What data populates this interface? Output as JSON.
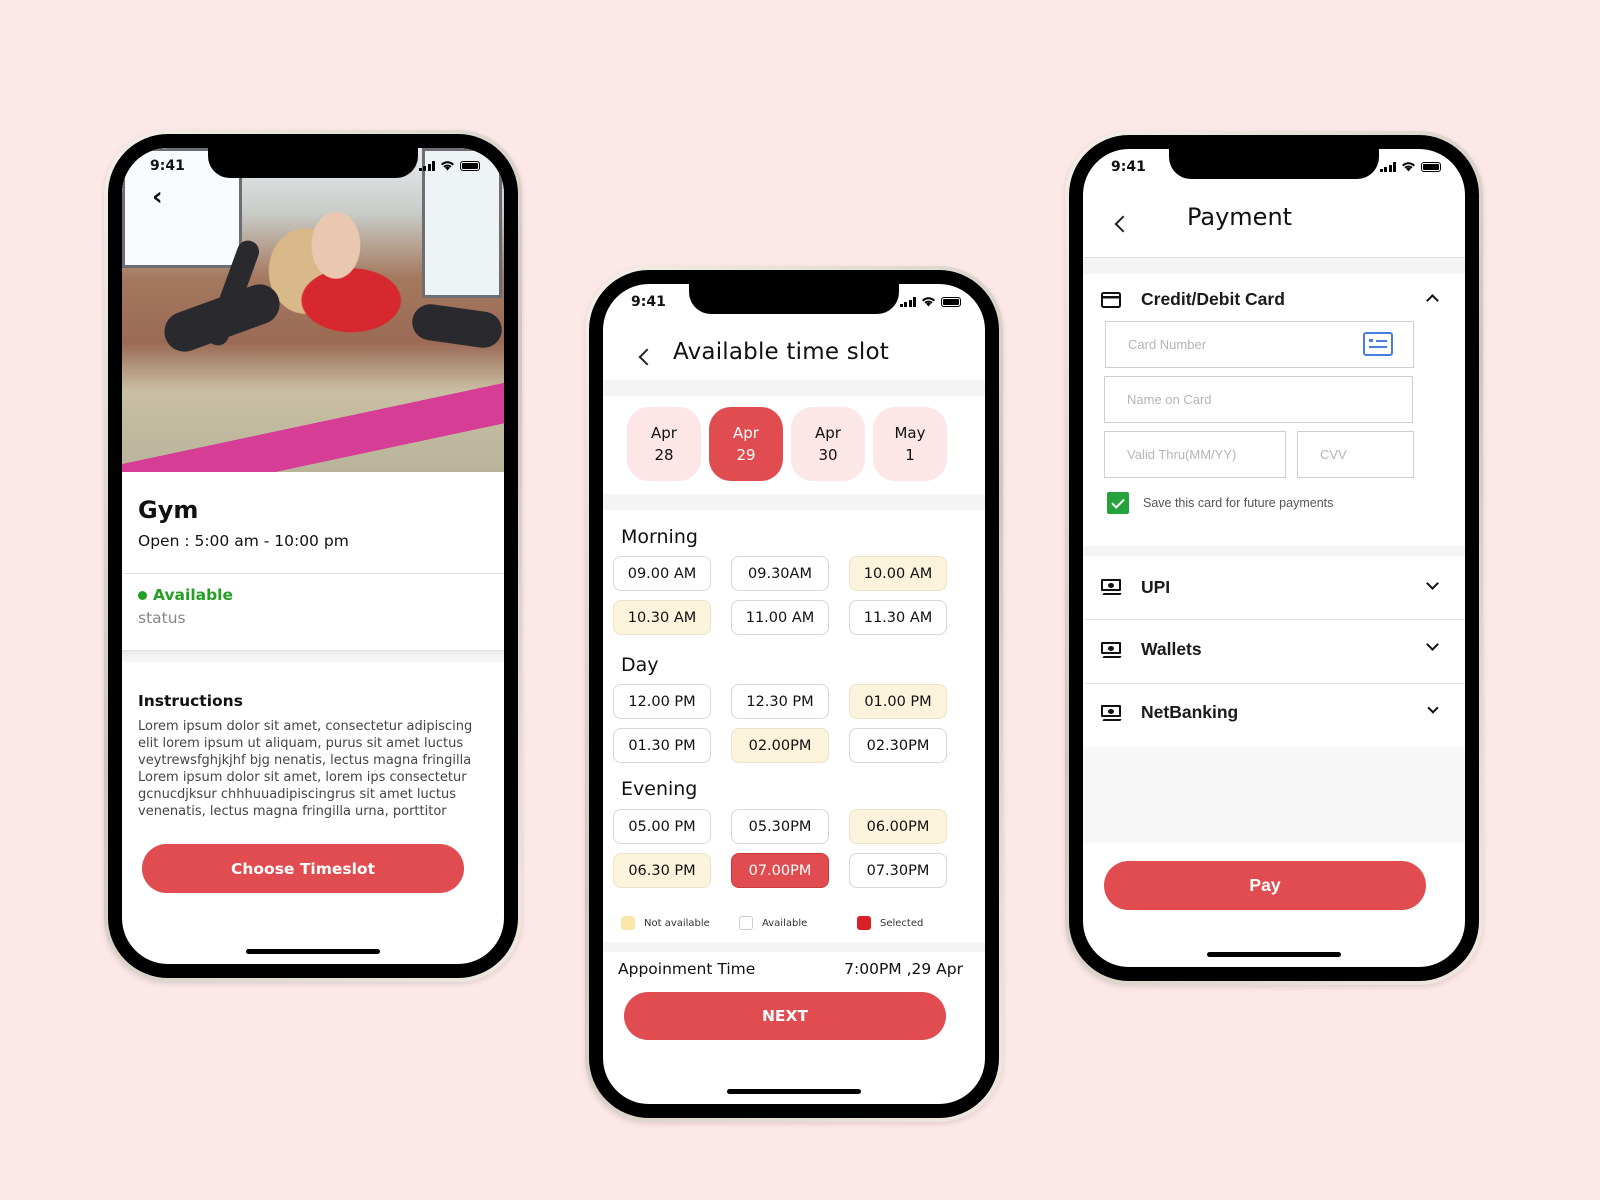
{
  "status_bar": {
    "time": "9:41"
  },
  "screen_gym": {
    "title": "Gym",
    "hours": "Open : 5:00 am - 10:00 pm",
    "status_value": "Available",
    "status_label": "status",
    "instructions_title": "Instructions",
    "instructions_text": "Lorem ipsum dolor sit amet, consectetur adipiscing elit lorem ipsum ut aliquam, purus sit amet luctus veytrewsfghjkjhf bjg nenatis, lectus magna fringilla Lorem ipsum dolor sit amet, lorem ips consectetur gcnucdjksur chhhuuadipiscingrus sit amet luctus venenatis, lectus magna fringilla urna, porttitor",
    "cta_label": "Choose Timeslot"
  },
  "screen_timeslot": {
    "title": "Available time slot",
    "dates": [
      {
        "month": "Apr",
        "day": "28",
        "selected": false
      },
      {
        "month": "Apr",
        "day": "29",
        "selected": true
      },
      {
        "month": "Apr",
        "day": "30",
        "selected": false
      },
      {
        "month": "May",
        "day": "1",
        "selected": false
      }
    ],
    "sections": [
      {
        "title": "Morning",
        "slots": [
          {
            "label": "09.00 AM",
            "state": "available"
          },
          {
            "label": "09.30AM",
            "state": "available"
          },
          {
            "label": "10.00 AM",
            "state": "not_available"
          },
          {
            "label": "10.30 AM",
            "state": "not_available"
          },
          {
            "label": "11.00 AM",
            "state": "available"
          },
          {
            "label": "11.30 AM",
            "state": "available"
          }
        ]
      },
      {
        "title": "Day",
        "slots": [
          {
            "label": "12.00 PM",
            "state": "available"
          },
          {
            "label": "12.30 PM",
            "state": "available"
          },
          {
            "label": "01.00 PM",
            "state": "not_available"
          },
          {
            "label": "01.30 PM",
            "state": "available"
          },
          {
            "label": "02.00PM",
            "state": "not_available"
          },
          {
            "label": "02.30PM",
            "state": "available"
          }
        ]
      },
      {
        "title": "Evening",
        "slots": [
          {
            "label": "05.00 PM",
            "state": "available"
          },
          {
            "label": "05.30PM",
            "state": "available"
          },
          {
            "label": "06.00PM",
            "state": "not_available"
          },
          {
            "label": "06.30 PM",
            "state": "not_available"
          },
          {
            "label": "07.00PM",
            "state": "selected"
          },
          {
            "label": "07.30PM",
            "state": "available"
          }
        ]
      }
    ],
    "legend": [
      {
        "label": "Not available",
        "color": "#fbe6a9"
      },
      {
        "label": "Available",
        "color": "#ffffff"
      },
      {
        "label": "Selected",
        "color": "#d92027"
      }
    ],
    "appointment_label": "Appoinment Time",
    "appointment_value": "7:00PM ,29 Apr",
    "cta_label": "NEXT"
  },
  "screen_payment": {
    "title": "Payment",
    "card_section": {
      "title": "Credit/Debit Card",
      "expanded": true,
      "card_number_placeholder": "Card Number",
      "name_placeholder": "Name on Card",
      "valid_thru_placeholder": "Valid Thru(MM/YY)",
      "cvv_placeholder": "CVV",
      "save_card_label": "Save this card for future payments",
      "save_card_checked": true
    },
    "methods": [
      {
        "label": "UPI",
        "icon": "cash-icon"
      },
      {
        "label": "Wallets",
        "icon": "cash-icon"
      },
      {
        "label": "NetBanking",
        "icon": "cash-icon"
      }
    ],
    "cta_label": "Pay"
  },
  "colors": {
    "accent": "#e04c4f",
    "available_green": "#23a023",
    "not_available": "#fcf3dc",
    "background": "#fde8e8"
  }
}
